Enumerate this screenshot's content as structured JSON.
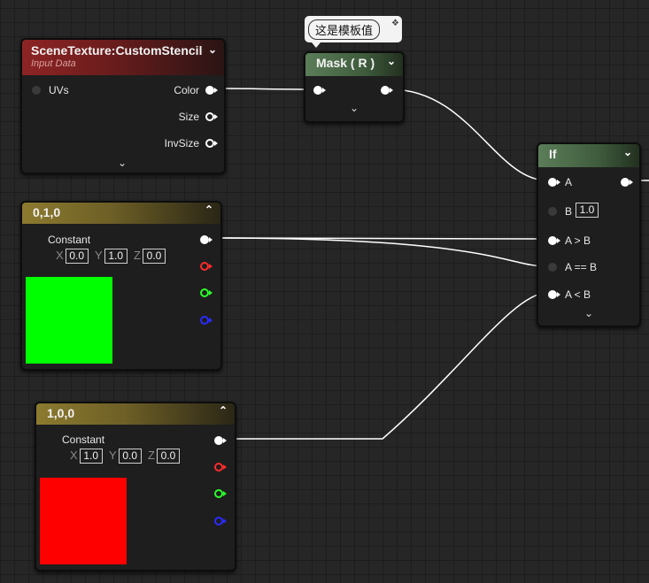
{
  "scene_node": {
    "title": "SceneTexture:CustomStencil",
    "subtitle": "Input Data",
    "input_uvs": "UVs",
    "outputs": [
      "Color",
      "Size",
      "InvSize"
    ]
  },
  "comment_bubble": {
    "text": "这是模板值"
  },
  "mask_node": {
    "title": "Mask ( R )"
  },
  "if_node": {
    "title": "If",
    "pin_a": "A",
    "pin_b": "B",
    "pin_b_value": "1.0",
    "pin_agtb": "A > B",
    "pin_aeqb": "A == B",
    "pin_altb": "A < B"
  },
  "const_green": {
    "title": "0,1,0",
    "label": "Constant",
    "x_label": "X",
    "x": "0.0",
    "y_label": "Y",
    "y": "1.0",
    "z_label": "Z",
    "z": "0.0",
    "swatch_color": "#00ff00"
  },
  "const_red": {
    "title": "1,0,0",
    "label": "Constant",
    "x_label": "X",
    "x": "1.0",
    "y_label": "Y",
    "y": "0.0",
    "z_label": "Z",
    "z": "0.0",
    "swatch_color": "#ff0000"
  },
  "icons": {
    "expand": "chevron-down-icon",
    "collapse": "chevron-up-icon",
    "pin": "pin-icon"
  },
  "colors": {
    "header_red": "#8d2424",
    "header_green": "#5b7d58",
    "header_gold": "#8c7a2f",
    "wire": "#ffffff",
    "pin_r": "#ff2a2a",
    "pin_g": "#2aff2a",
    "pin_b": "#2a2aff"
  }
}
